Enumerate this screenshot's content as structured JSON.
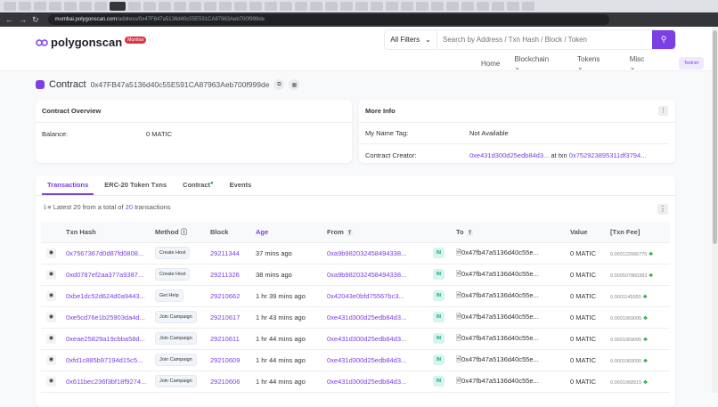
{
  "browser": {
    "url_host": "mumbai.polygonscan.com",
    "url_path": "/address/0x47F847a5136d40c55E591CA87963Aeb700f999de"
  },
  "header": {
    "logo": "polygonscan",
    "network_badge": "Mumbai",
    "filter_label": "All Filters",
    "search_placeholder": "Search by Address / Txn Hash / Block / Token",
    "nav": [
      "Home",
      "Blockchain",
      "Tokens",
      "Misc"
    ],
    "testnet": "Testnet"
  },
  "contract": {
    "label": "Contract",
    "address": "0x47FB47a5136d40c55E591CA87963Aeb700f999de"
  },
  "overview": {
    "title": "Contract Overview",
    "balance_label": "Balance:",
    "balance": "0 MATIC"
  },
  "more_info": {
    "title": "More Info",
    "name_tag_label": "My Name Tag:",
    "name_tag": "Not Available",
    "creator_label": "Contract Creator:",
    "creator": "0xe431d300d25edb84d3...",
    "at_txn": "at txn",
    "txn": "0x752923895311df3794..."
  },
  "tabs": [
    "Transactions",
    "ERC-20 Token Txns",
    "Contract",
    "Events"
  ],
  "summary": {
    "prefix": "Latest 20 from a total of",
    "count": "20",
    "suffix": "transactions"
  },
  "table": {
    "headers": [
      "Txn Hash",
      "Method",
      "Block",
      "Age",
      "From",
      "To",
      "Value",
      "[Txn Fee]"
    ],
    "rows": [
      {
        "hash": "0x7567367d0d87fd0808...",
        "method": "Create Host",
        "block": "29211344",
        "age": "37 mins ago",
        "from": "0xa9b982032458494338...",
        "dir": "IN",
        "to": "0x47fb47a5136d40c55e...",
        "value": "0 MATIC",
        "fee": "0.000122066775"
      },
      {
        "hash": "0xd0787ef2aa377a9387...",
        "method": "Create Host",
        "block": "29211326",
        "age": "38 mins ago",
        "from": "0xa9b982032458494338...",
        "dir": "IN",
        "to": "0x47fb47a5136d40c55e...",
        "value": "0 MATIC",
        "fee": "0.000507860383"
      },
      {
        "hash": "0xbe1dc52d624d0a9443...",
        "method": "Get Help",
        "block": "29210662",
        "age": "1 hr 39 mins ago",
        "from": "0x42043e0bfd75567bc3...",
        "dir": "IN",
        "to": "0x47fb47a5136d40c55e...",
        "value": "0 MATIC",
        "fee": "0.0001145955"
      },
      {
        "hash": "0xe5cd76e1b25903da4d...",
        "method": "Join Campaign",
        "block": "29210617",
        "age": "1 hr 43 mins ago",
        "from": "0xe431d300d25edb84d3...",
        "dir": "IN",
        "to": "0x47fb47a5136d40c55e...",
        "value": "0 MATIC",
        "fee": "0.0001069095"
      },
      {
        "hash": "0xeae25829a19cbba58d...",
        "method": "Join Campaign",
        "block": "29210611",
        "age": "1 hr 44 mins ago",
        "from": "0xe431d300d25edb84d3...",
        "dir": "IN",
        "to": "0x47fb47a5136d40c55e...",
        "value": "0 MATIC",
        "fee": "0.0001069095"
      },
      {
        "hash": "0xfd1c885b97194d15c5...",
        "method": "Join Campaign",
        "block": "29210609",
        "age": "1 hr 44 mins ago",
        "from": "0xe431d300d25edb84d3...",
        "dir": "IN",
        "to": "0x47fb47a5136d40c55e...",
        "value": "0 MATIC",
        "fee": "0.0001069095"
      },
      {
        "hash": "0x611bec236f3bf18f9274...",
        "method": "Join Campaign",
        "block": "29210606",
        "age": "1 hr 44 mins ago",
        "from": "0xe431d300d25edb84d3...",
        "dir": "IN",
        "to": "0x47fb47a5136d40c55e...",
        "value": "0 MATIC",
        "fee": "0.0001068915"
      }
    ]
  }
}
